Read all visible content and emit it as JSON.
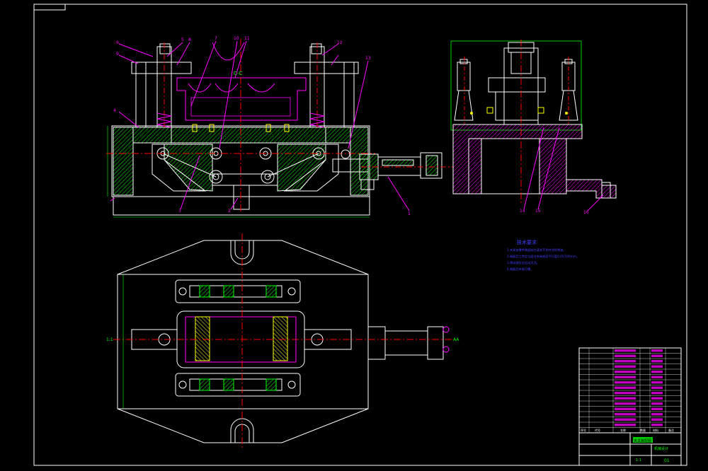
{
  "colors": {
    "background": "#000000",
    "frame": "#ffffff",
    "outline": "#ffffff",
    "leader": "#ff00ff",
    "hatch_green": "#00ff00",
    "hatch_magenta": "#ff00ff",
    "centerline": "#ff0000",
    "dimension": "#00ff00",
    "highlight": "#ffff00",
    "text_blue": "#4040ff"
  },
  "front_view": {
    "section_label": "C-C",
    "balloons": [
      "6",
      "9",
      "5",
      "8",
      "7",
      "10",
      "11",
      "12",
      "13",
      "4",
      "3",
      "2",
      "1"
    ]
  },
  "side_view": {
    "balloons": [
      "14",
      "15",
      "16"
    ]
  },
  "plan_view": {
    "left_mark": "1:1",
    "right_mark": "AA"
  },
  "technical_requirements": {
    "title": "技术要求",
    "items": [
      "1.夹具各零件装配前应清洗干净并涂防锈油。",
      "2.装配后工件定位面对夹具底面平行度0.05/100mm。",
      "3.滑动部位应运动灵活。",
      "4.装配后夹紧可靠。"
    ]
  },
  "title_block": {
    "drawing_name": "夹具装配图",
    "company": "机械设计",
    "scale": "1:1",
    "sheet": "01",
    "header_cells": [
      "序号",
      "代号",
      "名称",
      "数量",
      "材料",
      "备注"
    ]
  }
}
